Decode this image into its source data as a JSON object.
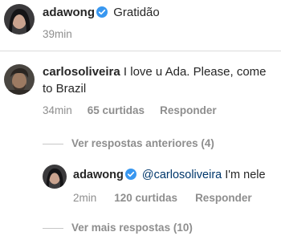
{
  "caption": {
    "username": "adawong",
    "text": "Gratidão",
    "time": "39min"
  },
  "comment": {
    "username": "carlosoliveira",
    "text_line1": "I love u Ada. Please, come",
    "text_line2": "to Brazil",
    "time": "34min",
    "likes": "65 curtidas",
    "reply": "Responder"
  },
  "view_previous": "Ver respostas anteriores (4)",
  "reply": {
    "username": "adawong",
    "mention": "@carlosoliveira",
    "text": "I'm nele",
    "time": "2min",
    "likes": "120 curtidas",
    "reply": "Responder"
  },
  "view_more": "Ver mais respostas (10)",
  "colors": {
    "verified": "#3897f0",
    "mention": "#00376b",
    "meta": "#8e8e8e",
    "text": "#262626"
  },
  "icons": {
    "verified": "verified-badge-icon"
  }
}
